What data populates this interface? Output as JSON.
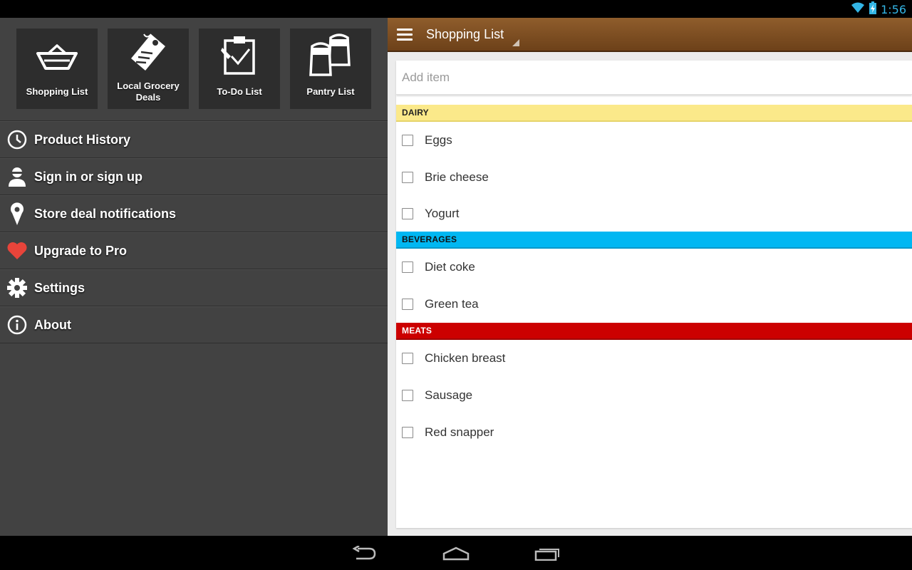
{
  "status": {
    "time": "1:56"
  },
  "drawer": {
    "tiles": [
      {
        "label": "Shopping List",
        "icon": "basket-icon"
      },
      {
        "label": "Local Grocery Deals",
        "icon": "price-tag-icon"
      },
      {
        "label": "To-Do List",
        "icon": "clipboard-check-icon"
      },
      {
        "label": "Pantry List",
        "icon": "salt-pepper-shakers-icon"
      }
    ],
    "menu": [
      {
        "label": "Product History",
        "icon": "clock-icon"
      },
      {
        "label": "Sign in or sign up",
        "icon": "user-icon"
      },
      {
        "label": "Store deal notifications",
        "icon": "location-pin-icon"
      },
      {
        "label": "Upgrade to Pro",
        "icon": "heart-icon",
        "icon_color": "#e8443a"
      },
      {
        "label": "Settings",
        "icon": "gear-icon"
      },
      {
        "label": "About",
        "icon": "info-icon"
      }
    ]
  },
  "main": {
    "title": "Shopping List",
    "add_item_placeholder": "Add item",
    "categories": [
      {
        "name": "DAIRY",
        "color": "#fbe98a",
        "items": [
          "Eggs",
          "Brie cheese",
          "Yogurt"
        ]
      },
      {
        "name": "BEVERAGES",
        "color": "#00b7f2",
        "items": [
          "Diet coke",
          "Green tea"
        ]
      },
      {
        "name": "MEATS",
        "color": "#cc0000",
        "items": [
          "Chicken breast",
          "Sausage",
          "Red snapper"
        ]
      }
    ]
  },
  "colors": {
    "actionbar": "#7a4c22",
    "drawer": "#424242",
    "accent_status": "#33b5e5"
  }
}
